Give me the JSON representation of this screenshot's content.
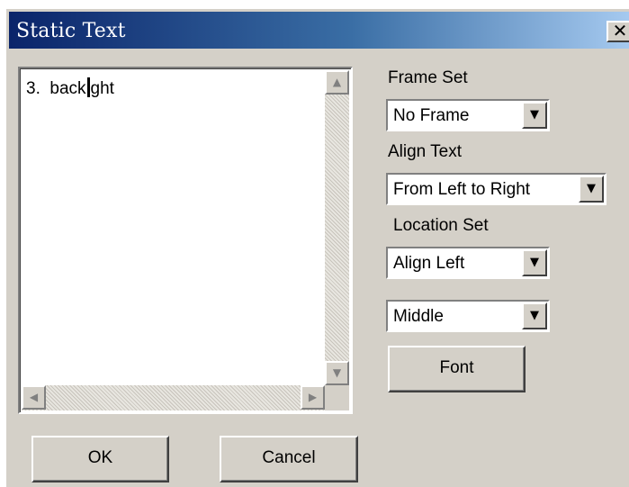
{
  "window": {
    "title": "Static Text",
    "close_glyph": "✕"
  },
  "editor": {
    "text_before_caret": "3.  back",
    "text_after_caret": "ght",
    "scroll_up_glyph": "▲",
    "scroll_down_glyph": "▼",
    "scroll_left_glyph": "◀",
    "scroll_right_glyph": "▶"
  },
  "frame_set": {
    "label": "Frame Set",
    "value": "No Frame"
  },
  "align_text": {
    "label": "Align Text",
    "value": "From Left to Right"
  },
  "location_set": {
    "label": "Location Set",
    "horizontal_value": "Align Left",
    "vertical_value": "Middle"
  },
  "dropdown_glyph": "▼",
  "buttons": {
    "font": "Font",
    "ok": "OK",
    "cancel": "Cancel"
  }
}
